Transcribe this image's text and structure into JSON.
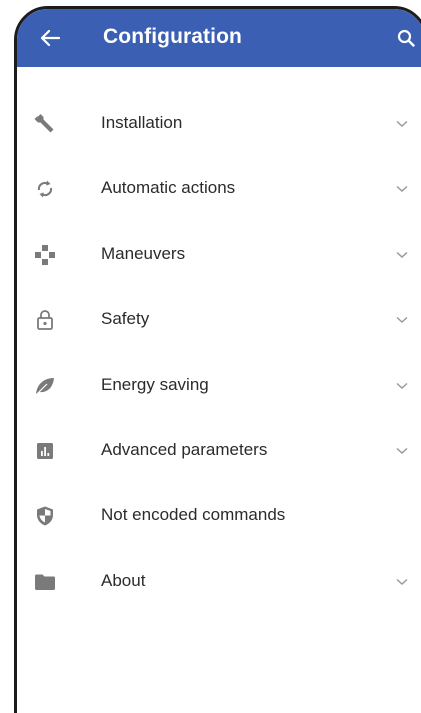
{
  "appbar": {
    "title": "Configuration",
    "back_icon": "arrow-left-icon",
    "search_icon": "search-icon",
    "background": "#3a5fb3"
  },
  "menu": {
    "items": [
      {
        "label": "Installation",
        "icon": "wrench-icon",
        "expandable": true
      },
      {
        "label": "Automatic actions",
        "icon": "sync-icon",
        "expandable": true
      },
      {
        "label": "Maneuvers",
        "icon": "dpad-icon",
        "expandable": true
      },
      {
        "label": "Safety",
        "icon": "lock-icon",
        "expandable": true
      },
      {
        "label": "Energy saving",
        "icon": "leaf-icon",
        "expandable": true
      },
      {
        "label": "Advanced parameters",
        "icon": "bar-chart-icon",
        "expandable": true
      },
      {
        "label": "Not encoded commands",
        "icon": "shield-icon",
        "expandable": false
      },
      {
        "label": "About",
        "icon": "folder-icon",
        "expandable": true
      }
    ]
  },
  "colors": {
    "icon_gray": "#7a7a7a",
    "chevron_gray": "#9a9a9a",
    "text": "#2b2b2b"
  }
}
